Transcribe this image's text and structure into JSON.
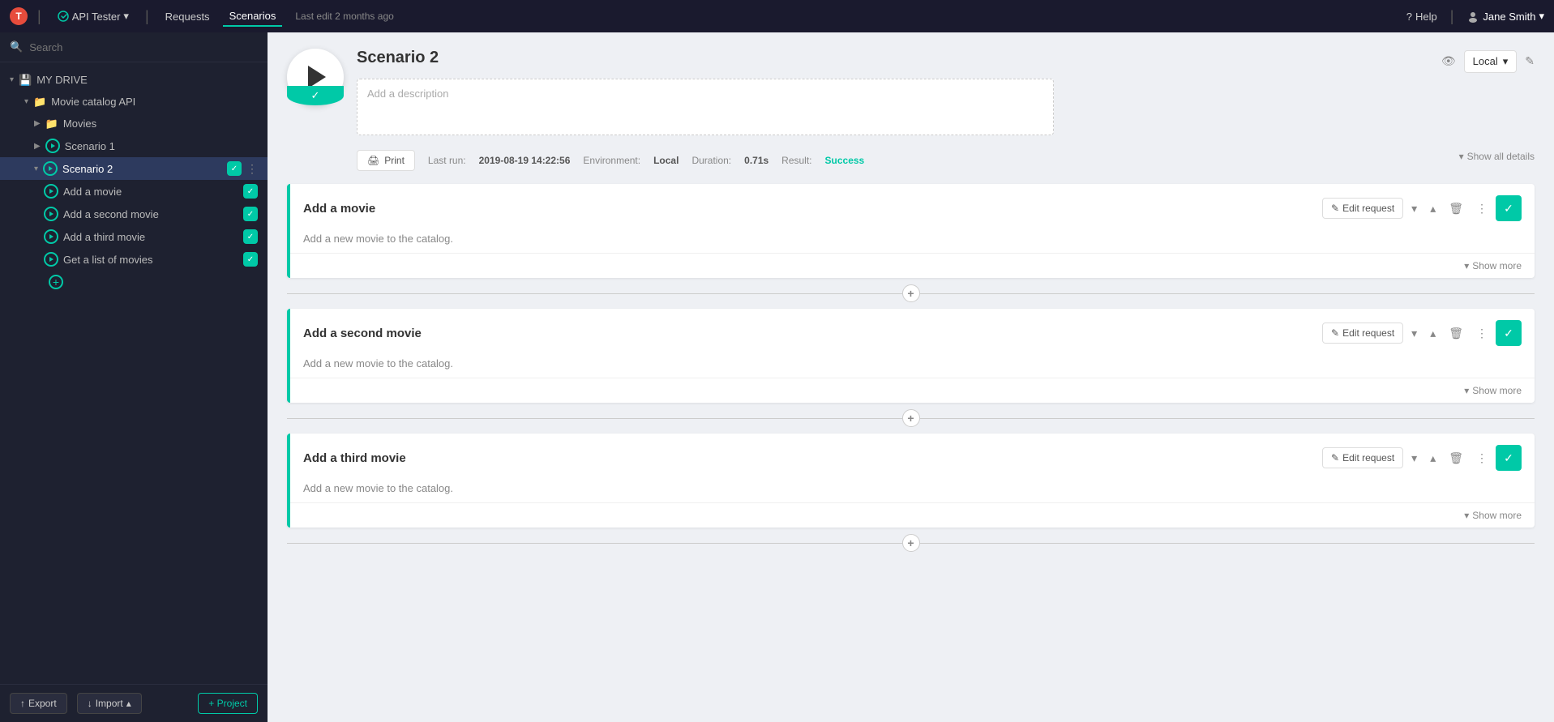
{
  "app": {
    "logo_text": "T",
    "name": "API Tester",
    "nav_items": [
      "Requests",
      "Scenarios"
    ],
    "active_nav": "Scenarios",
    "timestamp": "Last edit 2 months ago",
    "help_label": "Help",
    "user_name": "Jane Smith"
  },
  "sidebar": {
    "search_placeholder": "Search",
    "my_drive_label": "MY DRIVE",
    "tree": {
      "collection_label": "Movie catalog API",
      "movies_folder": "Movies",
      "scenarios": [
        {
          "label": "Scenario 1"
        },
        {
          "label": "Scenario 2",
          "active": true
        }
      ],
      "scenario2_children": [
        {
          "label": "Add a movie"
        },
        {
          "label": "Add a second movie"
        },
        {
          "label": "Add a third movie"
        },
        {
          "label": "Get a list of movies"
        }
      ]
    },
    "export_label": "Export",
    "import_label": "Import",
    "add_project_label": "+ Project"
  },
  "scenario": {
    "title": "Scenario 2",
    "description_placeholder": "Add a description",
    "last_run_label": "Last run:",
    "last_run_value": "2019-08-19 14:22:56",
    "environment_label": "Environment:",
    "environment_value": "Local",
    "duration_label": "Duration:",
    "duration_value": "0.71s",
    "result_label": "Result:",
    "result_value": "Success",
    "print_label": "Print",
    "env_select": "Local",
    "show_all_details": "Show all details"
  },
  "requests": [
    {
      "title": "Add a movie",
      "description": "Add a new movie to the catalog.",
      "edit_label": "Edit request",
      "show_more": "Show more"
    },
    {
      "title": "Add a second movie",
      "description": "Add a new movie to the catalog.",
      "edit_label": "Edit request",
      "show_more": "Show more"
    },
    {
      "title": "Add a third movie",
      "description": "Add a new movie to the catalog.",
      "edit_label": "Edit request",
      "show_more": "Show more"
    }
  ],
  "icons": {
    "play": "▶",
    "check": "✓",
    "plus": "+",
    "chevron_down": "▾",
    "chevron_up": "▴",
    "edit": "✎",
    "trash": "🗑",
    "more": "⋮",
    "eye": "👁",
    "print": "🖨",
    "search": "🔍",
    "folder": "📁",
    "drive": "💾",
    "arrow_down": "▾",
    "arrow_up": "▴"
  }
}
